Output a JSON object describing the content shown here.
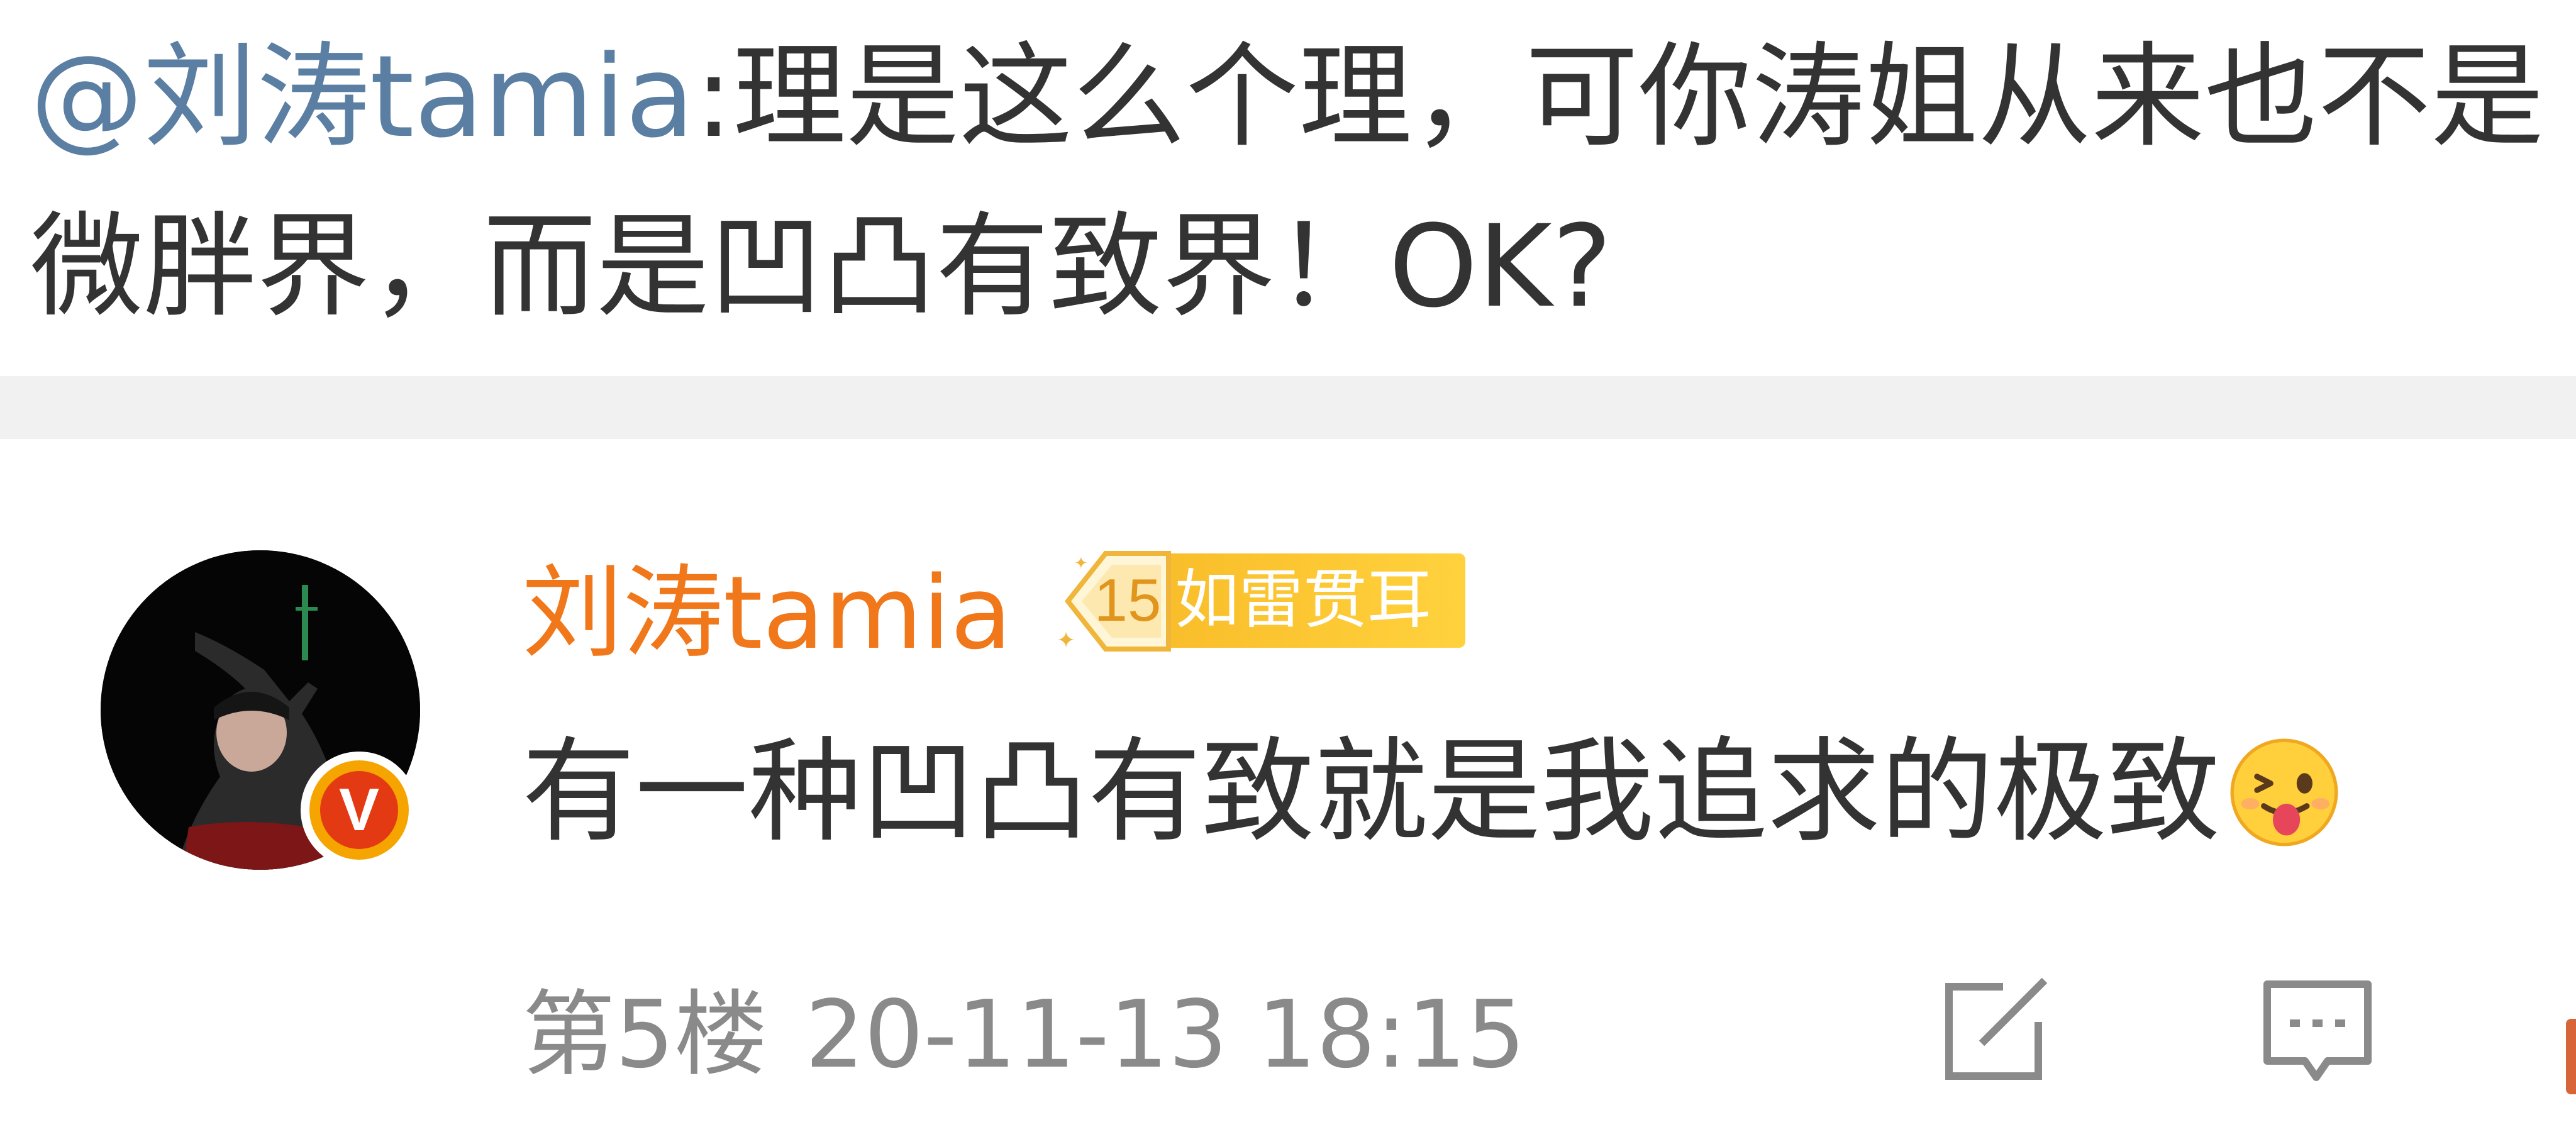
{
  "quoted_comment": {
    "mention": "@刘涛tamia",
    "text": ":理是这么个理，可你涛姐从来也不是微胖界，而是凹凸有致界！OK?"
  },
  "comment": {
    "username": "刘涛tamia",
    "level": "15",
    "badge_text": "如雷贯耳",
    "verified_icon": "v-verified-icon",
    "text": "有一种凹凸有致就是我追求的极致",
    "emoji": "tongue-wink-emoji",
    "floor": "第5楼",
    "time": "20-11-13 18:15"
  },
  "actions": {
    "repost_icon": "edit-share-icon",
    "reply_icon": "comment-icon"
  },
  "colors": {
    "mention": "#5b7ea3",
    "username": "#f0771a",
    "badge": "#f8bb28",
    "text": "#333333",
    "meta": "#8a8a8a"
  }
}
